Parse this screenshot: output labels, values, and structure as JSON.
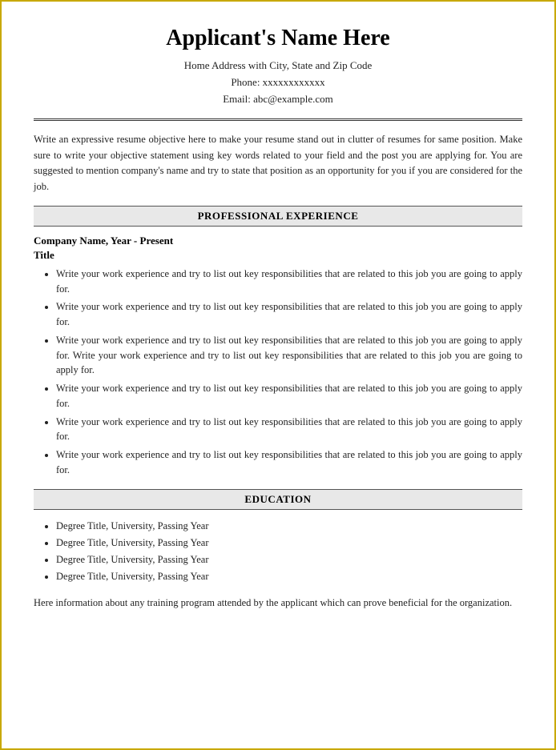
{
  "header": {
    "name": "Applicant's Name Here",
    "address": "Home Address with City, State and Zip Code",
    "phone": "Phone: xxxxxxxxxxxx",
    "email": "Email: abc@example.com"
  },
  "objective": {
    "text": "Write an expressive resume objective here to make your resume stand out in clutter of resumes for same position. Make sure to write your objective statement using key words related to your field and the post you are applying for. You are suggested to mention company's name and try to state that position as an opportunity for you if you are considered for the job."
  },
  "sections": {
    "experience_header": "PROFESSIONAL EXPERIENCE",
    "education_header": "EDUCATION"
  },
  "experience": {
    "company": "Company Name, Year - Present",
    "title": "Title",
    "bullet_text": "Write your work experience and try to list out key responsibilities that are related to this job you are going to apply for.",
    "bullet_long": "Write your work experience and try to list out key responsibilities that are related to this job you are going to apply for. Write your work experience and try to list out key responsibilities that are related to this job you are going to apply for.",
    "bullets": [
      "Write your work experience and try to list out key responsibilities that are related to this job you are going to apply for.",
      "Write your work experience and try to list out key responsibilities that are related to this job you are going to apply for.",
      "Write your work experience and try to list out key responsibilities that are related to this job you are going to apply for. Write your work experience and try to list out key responsibilities that are related to this job you are going to apply for.",
      "Write your work experience and try to list out key responsibilities that are related to this job you are going to apply for.",
      "Write your work experience and try to list out key responsibilities that are related to this job you are going to apply for.",
      "Write your work experience and try to list out key responsibilities that are related to this job you are going to apply for."
    ]
  },
  "education": {
    "degrees": [
      "Degree Title, University, Passing Year",
      "Degree Title, University, Passing Year",
      "Degree Title, University, Passing Year",
      "Degree Title, University, Passing Year"
    ],
    "training": "Here information about any training program attended by the applicant which can prove beneficial for the organization."
  }
}
